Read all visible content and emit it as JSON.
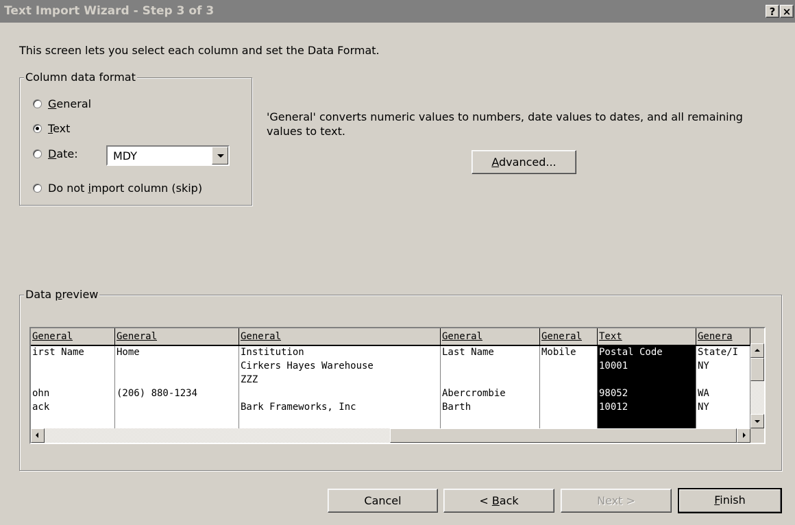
{
  "window": {
    "title": "Text Import Wizard - Step 3 of 3",
    "help_label": "?",
    "close_label": "×"
  },
  "intro": "This screen lets you select each column and set the Data Format.",
  "column_format": {
    "legend": "Column data format",
    "options": [
      {
        "pre": "",
        "key": "G",
        "post": "eneral",
        "checked": false
      },
      {
        "pre": "",
        "key": "T",
        "post": "ext",
        "checked": true
      },
      {
        "pre": "",
        "key": "D",
        "post": "ate:",
        "checked": false
      },
      {
        "pre": "Do not ",
        "key": "i",
        "post": "mport column (skip)",
        "checked": false
      }
    ],
    "date_value": "MDY"
  },
  "description": "'General' converts numeric values to numbers, date values to dates, and all remaining values to text.",
  "advanced": {
    "key": "A",
    "rest": "dvanced..."
  },
  "preview": {
    "legend_pre": "Data ",
    "legend_key": "p",
    "legend_post": "review",
    "columns": [
      {
        "header": "General",
        "rows": [
          "irst Name",
          "",
          "",
          "ohn",
          "ack"
        ],
        "selected": false
      },
      {
        "header": "General",
        "rows": [
          "Home",
          "",
          "",
          "(206) 880-1234",
          ""
        ],
        "selected": false
      },
      {
        "header": "General",
        "rows": [
          "Institution",
          "Cirkers Hayes Warehouse",
          "ZZZ",
          "",
          "Bark Frameworks, Inc"
        ],
        "selected": false
      },
      {
        "header": "General",
        "rows": [
          "Last Name",
          "",
          "",
          "Abercrombie",
          "Barth"
        ],
        "selected": false
      },
      {
        "header": "General",
        "rows": [
          "Mobile",
          "",
          "",
          "",
          ""
        ],
        "selected": false
      },
      {
        "header": "Text",
        "rows": [
          "Postal Code",
          "10001",
          "",
          "98052",
          "10012"
        ],
        "selected": true
      },
      {
        "header": "Genera",
        "rows": [
          "State/I",
          "NY",
          "",
          "WA",
          "NY"
        ],
        "selected": false
      }
    ]
  },
  "buttons": {
    "cancel": "Cancel",
    "back": {
      "pre": "< ",
      "key": "B",
      "post": "ack"
    },
    "next": "Next >",
    "finish": {
      "key": "F",
      "post": "inish"
    }
  }
}
